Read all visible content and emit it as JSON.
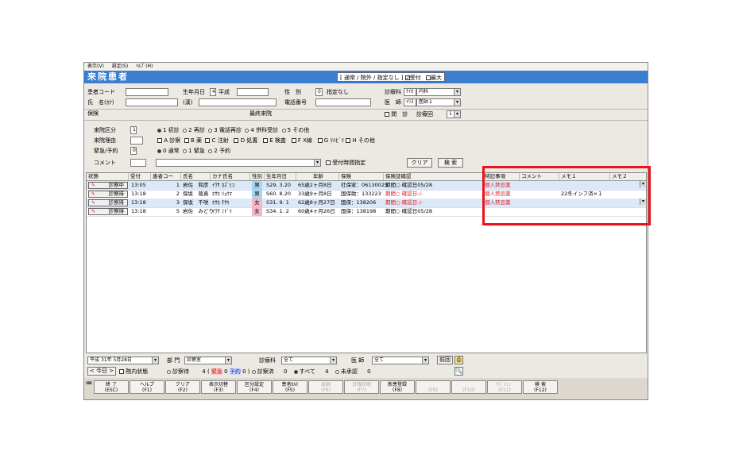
{
  "menu": [
    "表示(V)",
    "設定(S)",
    "ﾍﾙﾌﾟ(H)"
  ],
  "title": "来院患者",
  "mode_box": {
    "text": "[ 通常 / 院外 / 指定なし ]",
    "checks": [
      {
        "label": "受付",
        "checked": true
      },
      {
        "label": "最大",
        "checked": false
      }
    ]
  },
  "form": {
    "patient_code_label": "患者コード",
    "patient_code_value": "",
    "name_kana_label": "氏　名(ｶﾅ)",
    "name_kanji_label": "(漢)",
    "birth_label": "生年月日",
    "birth_era_code": "4",
    "birth_era": "平成",
    "sex_label": "性　別",
    "sex_code": "0",
    "sex_value": "指定なし",
    "phone_label": "電話番号",
    "dept_label": "診療科",
    "dept_code": "ﾅｲｶ",
    "dept_value": "内科",
    "doctor_label": "医　師",
    "doctor_code": "ｲﾘﾖ",
    "doctor_value": "医師１",
    "insurance_label": "保険",
    "last_visit_label": "最終来院",
    "question_label": "問　診",
    "visit_count_label": "診療回",
    "visit_count_value": "1"
  },
  "options": {
    "visit_type_label": "来院区分",
    "visit_type_value": "1",
    "visit_types": [
      "1 初診",
      "2 再診",
      "3 電話再診",
      "4 併科受診",
      "5 その他"
    ],
    "visit_reason_label": "来院理由",
    "visit_reasons": [
      "A 診察",
      "B 薬",
      "C 注射",
      "D 処置",
      "E 検査",
      "F X線",
      "G ﾘﾊﾋﾞﾘ",
      "H その他"
    ],
    "urgent_label": "緊急/予約",
    "urgent_value": "0",
    "urgent_options": [
      "0 通常",
      "1 緊急",
      "2 予約"
    ],
    "comment_label": "コメント",
    "reception_time_label": "受付時間指定",
    "clear_label": "クリア",
    "search_label": "検 索"
  },
  "table": {
    "headers": [
      "状態",
      "受付",
      "患者コー",
      "氏名",
      "カナ氏名",
      "性別",
      "生年月日",
      "年齢",
      "保険",
      "保険証確認",
      "特記事項",
      "コメント",
      "メモ１",
      "メモ２"
    ],
    "rows": [
      {
        "status": "診察中",
        "time": "13:05",
        "code": "1",
        "name": "岩佐　和彦",
        "kana": "ｲﾜｻ ｶｽﾞﾋｺ",
        "sex": "男",
        "birth": "S29. 3.20",
        "age": "65歳2ヶ月8日",
        "insurance": "社保家：06130025",
        "check": "期間○ 確認日05/28",
        "check_red": false,
        "special": "個人禁忌薬",
        "comment": "",
        "memo1": "",
        "memo2": ""
      },
      {
        "status": "診察待",
        "time": "13:18",
        "code": "2",
        "name": "保坂　陵真",
        "kana": "ﾎｻｶ ﾘｮｳﾏ",
        "sex": "男",
        "birth": "S60. 8.20",
        "age": "33歳9ヶ月8日",
        "insurance": "国保助：133223",
        "check": "期間○ 確認日-/-",
        "check_red": true,
        "special": "個人禁忌薬",
        "comment": "",
        "memo1": "22冬インフ済×１",
        "memo2": ""
      },
      {
        "status": "診察待",
        "time": "13:18",
        "code": "3",
        "name": "保坂　千咲",
        "kana": "ﾎｻｶ ﾁｻｷ",
        "sex": "女",
        "birth": "S31. 9. 1",
        "age": "62歳8ヶ月27日",
        "insurance": "国保：138206",
        "check": "期間○ 確認日-/-",
        "check_red": true,
        "special": "個人禁忌薬",
        "comment": "",
        "memo1": "",
        "memo2": ""
      },
      {
        "status": "診察待",
        "time": "13:18",
        "code": "5",
        "name": "岩佐　みどり",
        "kana": "ｲﾜｻ ﾐﾄﾞﾘ",
        "sex": "女",
        "birth": "S34. 1. 2",
        "age": "60歳4ヶ月26日",
        "insurance": "国保：138198",
        "check": "期間○ 確認日05/28",
        "check_red": false,
        "special": "",
        "comment": "",
        "memo1": "",
        "memo2": ""
      }
    ]
  },
  "bottom": {
    "date_era": "平成",
    "date_value": "31年 5月28日",
    "today_label": "今日",
    "in_hospital_label": "院内状態",
    "dept_label": "部 門",
    "dept_value": "診察室",
    "clinic_label": "診療科",
    "clinic_value": "全て",
    "doctor_label": "医 師",
    "doctor_value": "全て",
    "prev_label": "前回",
    "waiting_label": "診察待",
    "waiting_count": "4",
    "urgent_label": "緊急",
    "urgent_count": "0",
    "reserve_label": "予約",
    "reserve_count": "0",
    "done_label": "診察済",
    "done_count": "0",
    "all_label": "すべて",
    "all_count": "4",
    "unaccepted_label": "未承認",
    "unaccepted_count": "0"
  },
  "fkeys": [
    {
      "label": "終 了",
      "key": "(ESC)",
      "disabled": false
    },
    {
      "label": "ヘルプ",
      "key": "(F1)",
      "disabled": false
    },
    {
      "label": "クリア",
      "key": "(F2)",
      "disabled": false
    },
    {
      "label": "表示切替",
      "key": "(F3)",
      "disabled": false
    },
    {
      "label": "区分設定",
      "key": "(F4)",
      "disabled": false
    },
    {
      "label": "患者ｶﾙﾃ",
      "key": "(F5)",
      "disabled": false
    },
    {
      "label": "出納",
      "key": "(F6)",
      "disabled": true
    },
    {
      "label": "日報印刷",
      "key": "(F7)",
      "disabled": true
    },
    {
      "label": "新患登録",
      "key": "(F8)",
      "disabled": false
    },
    {
      "label": "",
      "key": "(F9)",
      "disabled": true
    },
    {
      "label": "",
      "key": "(F10)",
      "disabled": true
    },
    {
      "label": "ｻﾌﾞﾒﾆｭｰ",
      "key": "(F11)",
      "disabled": true
    },
    {
      "label": "検 索",
      "key": "(F12)",
      "disabled": false
    }
  ],
  "colors": {
    "title_bar": "#3b7dd0",
    "highlight": "#e8141e",
    "male": "#a8d4f0",
    "female": "#f5b8c8"
  }
}
